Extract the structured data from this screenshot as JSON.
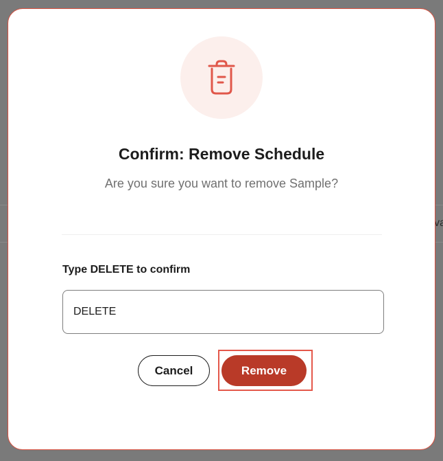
{
  "dialog": {
    "title": "Confirm: Remove Schedule",
    "message": "Are you sure you want to remove Sample?",
    "icon": "trash-icon",
    "confirm_label": "Type DELETE to confirm",
    "confirm_input_value": "DELETE",
    "cancel_label": "Cancel",
    "remove_label": "Remove"
  },
  "background": {
    "partial_text": "va"
  },
  "colors": {
    "danger": "#b93a28",
    "icon_background": "#fcefec",
    "icon_stroke": "#e0574a",
    "overlay": "#7a7a7a"
  }
}
